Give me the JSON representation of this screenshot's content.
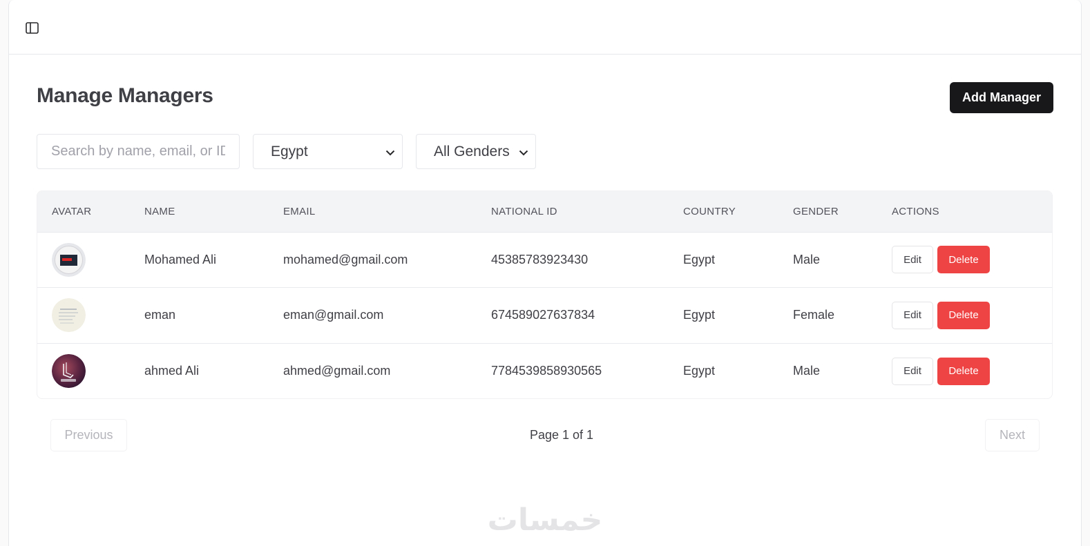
{
  "header": {
    "toggle_icon": "sidebar-toggle-icon"
  },
  "page": {
    "title": "Manage Managers",
    "add_button_label": "Add Manager"
  },
  "filters": {
    "search_placeholder": "Search by name, email, or ID",
    "search_value": "",
    "country_selected": "Egypt",
    "gender_selected": "All Genders"
  },
  "table": {
    "headers": [
      "AVATAR",
      "NAME",
      "EMAIL",
      "NATIONAL ID",
      "COUNTRY",
      "GENDER",
      "ACTIONS"
    ],
    "rows": [
      {
        "name": "Mohamed Ali",
        "email": "mohamed@gmail.com",
        "national_id": "45385783923430",
        "country": "Egypt",
        "gender": "Male",
        "edit": "Edit",
        "delete": "Delete"
      },
      {
        "name": "eman",
        "email": "eman@gmail.com",
        "national_id": "674589027637834",
        "country": "Egypt",
        "gender": "Female",
        "edit": "Edit",
        "delete": "Delete"
      },
      {
        "name": "ahmed Ali",
        "email": "ahmed@gmail.com",
        "national_id": "7784539858930565",
        "country": "Egypt",
        "gender": "Male",
        "edit": "Edit",
        "delete": "Delete"
      }
    ]
  },
  "pagination": {
    "previous_label": "Previous",
    "next_label": "Next",
    "page_info": "Page 1 of 1"
  },
  "watermark": {
    "text": "خمسات"
  },
  "colors": {
    "primary": "#18181b",
    "danger": "#ef4444",
    "header_bg": "#f3f4f6"
  }
}
